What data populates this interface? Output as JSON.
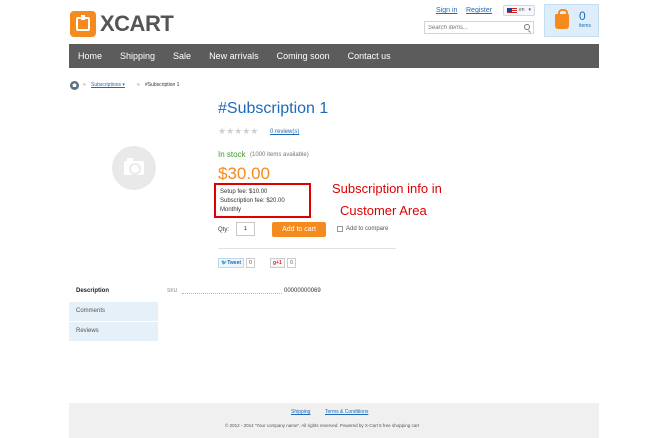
{
  "header": {
    "logo_text": "XCART",
    "sign_in": "Sign in",
    "register": "Register",
    "language_code": "en",
    "search_placeholder": "Search items...",
    "cart_count": "0",
    "cart_label": "items"
  },
  "nav": {
    "items": [
      {
        "label": "Home"
      },
      {
        "label": "Shipping"
      },
      {
        "label": "Sale"
      },
      {
        "label": "New arrivals"
      },
      {
        "label": "Coming soon"
      },
      {
        "label": "Contact us"
      }
    ]
  },
  "breadcrumb": {
    "separator": "»",
    "link": "Subscriptions ▾",
    "current": "#Subscription 1"
  },
  "product": {
    "title": "#Subscription 1",
    "stars": "★★★★★",
    "rating_stars_filled": 0,
    "reviews_link": "0 review(s)",
    "stock_status": "In stock",
    "stock_note": "(1000 items available)",
    "price": "$30.00",
    "setup_fee": "Setup fee: $10.00",
    "subscription_fee": "Subscription fee: $20.00",
    "period": "Monthly",
    "qty_label": "Qty:",
    "qty_value": "1",
    "add_to_cart": "Add to cart",
    "add_to_compare": "Add to compare",
    "tweet_label": "Tweet",
    "tweet_count": "0",
    "gplus_label": "g+1",
    "gplus_count": "0"
  },
  "annotation": {
    "line1": "Subscription info in",
    "line2": "Customer Area",
    "color": "#e00000"
  },
  "tabs": [
    {
      "label": "Description"
    },
    {
      "label": "Comments"
    },
    {
      "label": "Reviews"
    }
  ],
  "specs": {
    "sku_label": "SKU",
    "sku_value": "00000000069"
  },
  "footer": {
    "links": [
      {
        "label": "Shipping"
      },
      {
        "label": "Terms & Conditions"
      }
    ],
    "copyright": "© 2012 - 2014 \"Your company name\". All rights reserved. Powered by X-Cart 5 free shopping cart"
  },
  "colors": {
    "brand_orange": "#f58a1f",
    "link_blue": "#1e6bb8",
    "nav_bg": "#5c5c5c",
    "in_stock_green": "#3a9d23"
  }
}
